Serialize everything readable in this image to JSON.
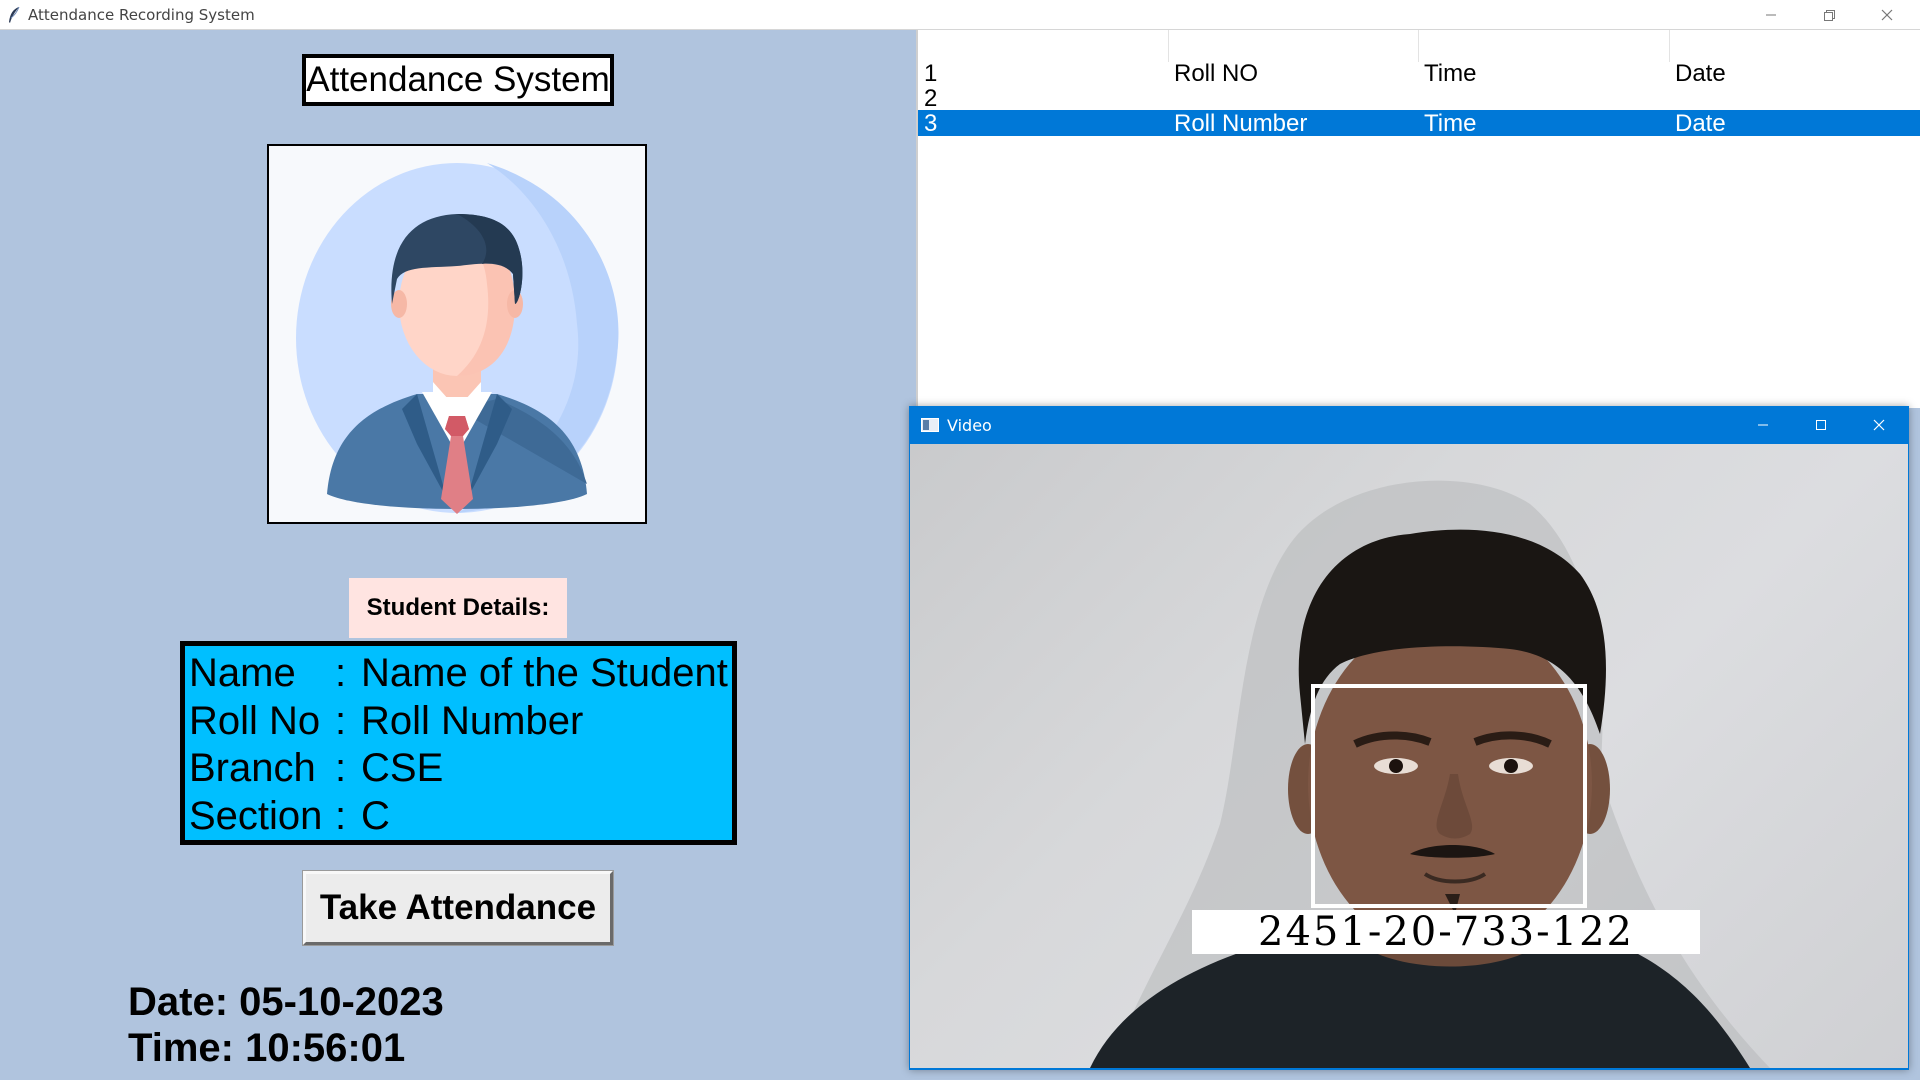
{
  "window": {
    "title": "Attendance Recording System"
  },
  "left": {
    "heading": "Attendance System",
    "details_label": "Student Details:",
    "details": [
      {
        "key": "Name",
        "sep": ":",
        "value": "Name of the Student"
      },
      {
        "key": "Roll No",
        "sep": ":",
        "value": "Roll Number"
      },
      {
        "key": "Branch",
        "sep": ":",
        "value": "CSE"
      },
      {
        "key": "Section",
        "sep": ":",
        "value": "C"
      }
    ],
    "take_attendance_label": "Take Attendance",
    "date_text": "Date: 05-10-2023",
    "time_text": "Time: 10:56:01"
  },
  "table": {
    "rows": [
      {
        "cells": [
          "1",
          "Roll NO",
          "Time",
          "Date"
        ],
        "selected": false
      },
      {
        "cells": [
          "2",
          "",
          "",
          ""
        ],
        "selected": false
      },
      {
        "cells": [
          "3",
          "Roll Number",
          "Time",
          "Date"
        ],
        "selected": true
      }
    ],
    "selection_color": "#0078d7"
  },
  "video_window": {
    "title": "Video",
    "detected_label": "2451-20-733-122"
  },
  "icons": {
    "app": "feather-icon",
    "minimize": "minimize-icon",
    "restore": "restore-icon",
    "close": "close-icon",
    "video_app": "video-window-icon",
    "maximize": "maximize-icon"
  },
  "colors": {
    "background": "#b0c4de",
    "details_box": "#00bfff",
    "details_label_bg": "#ffe4e1",
    "accent": "#0078d7"
  }
}
